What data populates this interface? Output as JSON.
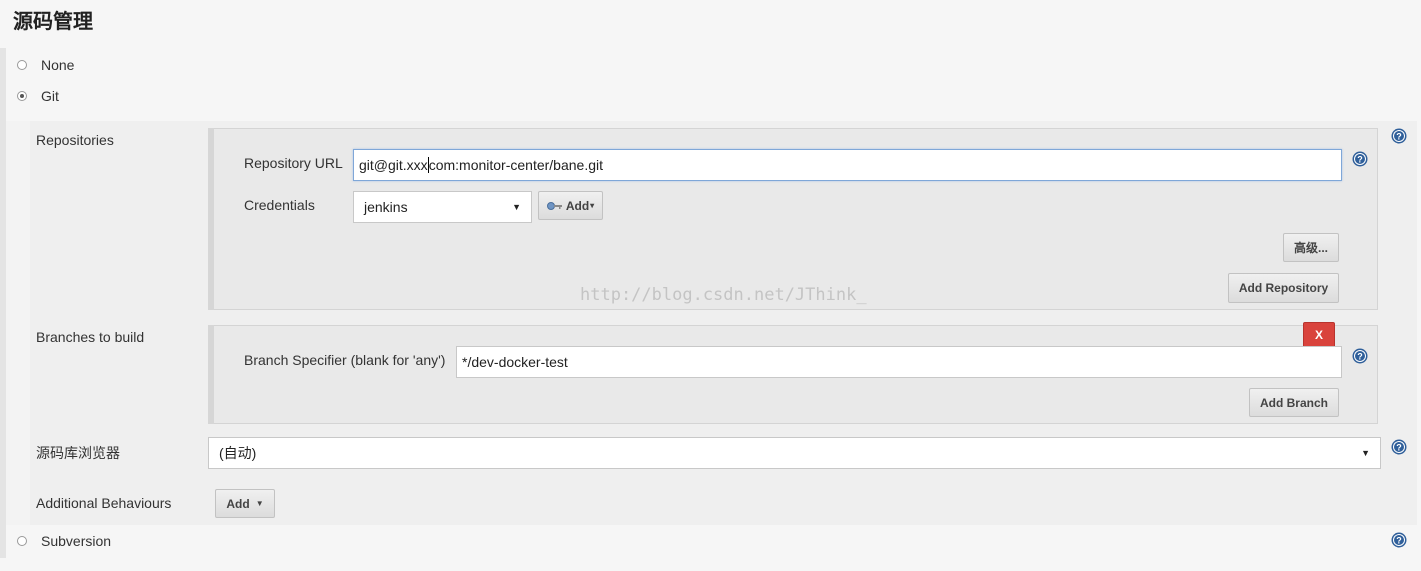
{
  "section_title": "源码管理",
  "scm_options": {
    "none": "None",
    "git": "Git",
    "subversion": "Subversion"
  },
  "git": {
    "repositories_label": "Repositories",
    "repository_url_label": "Repository URL",
    "repository_url_value_before_caret": "git@git.xxx",
    "repository_url_value_after_caret": "com:monitor-center/bane.git",
    "credentials_label": "Credentials",
    "credentials_selected": "jenkins",
    "credentials_add_button": "Add",
    "advanced_button": "高级...",
    "add_repository_button": "Add Repository",
    "branches_label": "Branches to build",
    "branch_specifier_label": "Branch Specifier (blank for 'any')",
    "branch_specifier_value": "*/dev-docker-test",
    "delete_branch_button": "X",
    "add_branch_button": "Add Branch",
    "repo_browser_label": "源码库浏览器",
    "repo_browser_selected": "(自动)",
    "additional_behaviours_label": "Additional Behaviours",
    "additional_behaviours_add_button": "Add"
  },
  "watermark": "http://blog.csdn.net/JThink_",
  "icons": {
    "help": "help-icon",
    "key": "key-icon",
    "dropdown": "chevron-down-icon"
  },
  "colors": {
    "help_icon": "#2f5f9a",
    "delete_button": "#d9433c",
    "focus_border": "#7fa7d8"
  }
}
